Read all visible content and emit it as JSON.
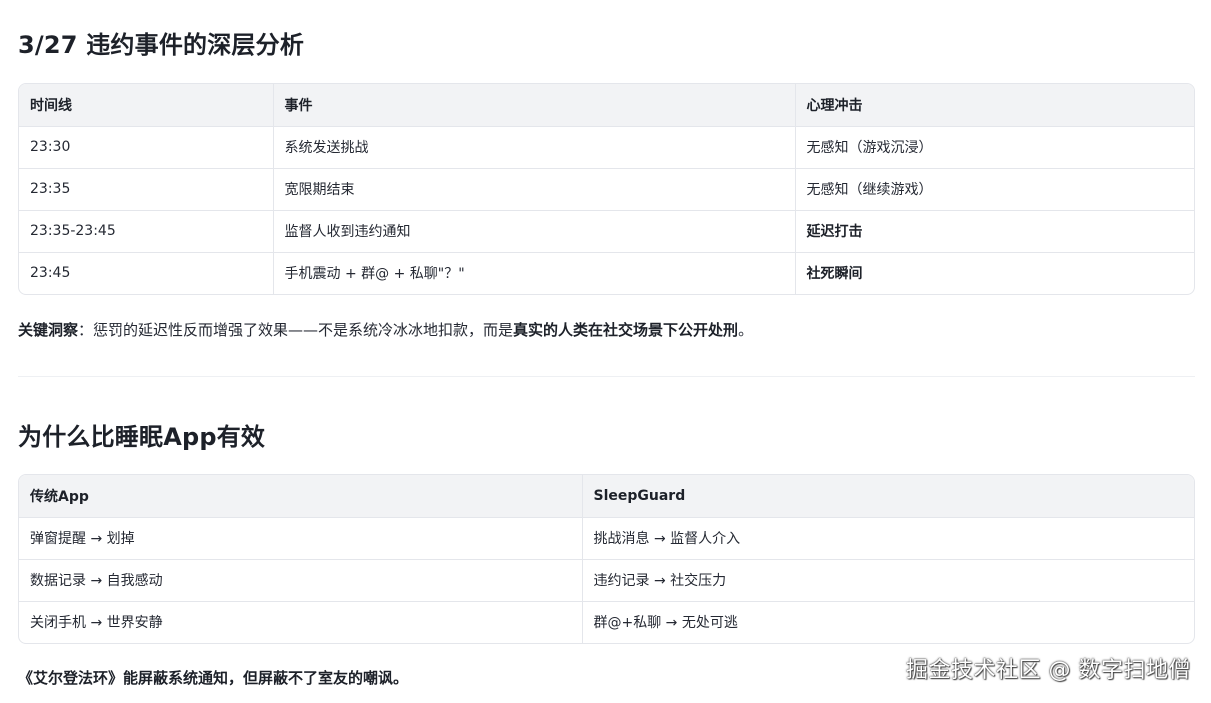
{
  "section1": {
    "heading": "3/27 违约事件的深层分析",
    "table": {
      "headers": [
        "时间线",
        "事件",
        "心理冲击"
      ],
      "rows": [
        [
          "23:30",
          "系统发送挑战",
          "无感知（游戏沉浸）"
        ],
        [
          "23:35",
          "宽限期结束",
          "无感知（继续游戏）"
        ],
        [
          "23:35-23:45",
          "监督人收到违约通知",
          "延迟打击"
        ],
        [
          "23:45",
          "手机震动 + 群@ + 私聊\"？\"",
          "社死瞬间"
        ]
      ]
    },
    "insight": {
      "label": "关键洞察",
      "colon": "：",
      "text": "惩罚的延迟性反而增强了效果——不是系统冷冰冰地扣款，而是",
      "emphasis": "真实的人类在社交场景下公开处刑",
      "end": "。"
    }
  },
  "section2": {
    "heading": "为什么比睡眠App有效",
    "table": {
      "headers": [
        "传统App",
        "SleepGuard"
      ],
      "rows": [
        [
          "弹窗提醒 → 划掉",
          "挑战消息 → 监督人介入"
        ],
        [
          "数据记录 → 自我感动",
          "违约记录 → 社交压力"
        ],
        [
          "关闭手机 → 世界安静",
          "群@+私聊 → 无处可逃"
        ]
      ]
    },
    "closing": "《艾尔登法环》能屏蔽系统通知，但屏蔽不了室友的嘲讽。"
  },
  "watermark": "掘金技术社区 @ 数字扫地僧"
}
